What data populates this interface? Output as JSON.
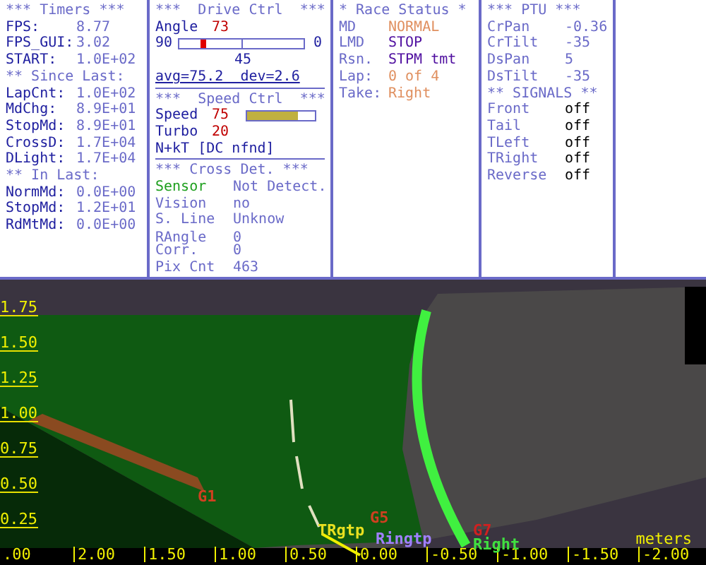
{
  "timers": {
    "sections": [
      {
        "title": "*** Timers ***",
        "rows": [
          {
            "label": "FPS:",
            "value": "8.77"
          },
          {
            "label": "FPS_GUI:",
            "value": "3.02"
          },
          {
            "label": "START:",
            "value": "1.0E+02"
          }
        ]
      },
      {
        "title": "** Since Last:",
        "rows": [
          {
            "label": "LapCnt:",
            "value": "1.0E+02"
          },
          {
            "label": "MdChg:",
            "value": "8.9E+01"
          },
          {
            "label": "StopMd:",
            "value": "8.9E+01"
          },
          {
            "label": "CrossD:",
            "value": "1.7E+04"
          },
          {
            "label": "DLight:",
            "value": "1.7E+04"
          }
        ]
      },
      {
        "title": "** In Last:",
        "rows": [
          {
            "label": "NormMd:",
            "value": "0.0E+00"
          },
          {
            "label": "StopMd:",
            "value": "1.2E+01"
          },
          {
            "label": "RdMtMd:",
            "value": "0.0E+00"
          }
        ]
      }
    ]
  },
  "drive_ctrl": {
    "title": "***  Drive Ctrl  ***",
    "angle_label": "Angle",
    "angle_value": "73",
    "slider_min": "90",
    "slider_max": "0",
    "level": 0.19,
    "slider_mid": "45",
    "stats": "avg=75.2  dev=2.6"
  },
  "speed_ctrl": {
    "title": "***  Speed Ctrl  ***",
    "speed_label": "Speed",
    "speed_value": "75",
    "level": 0.75,
    "turbo_label": "Turbo",
    "turbo_value": "20",
    "mode": "N+kT [DC nfnd]"
  },
  "cross_det": {
    "title": "*** Cross Det. ***",
    "rows": [
      {
        "label": "Sensor",
        "value": "Not Detect.",
        "highlighted": true
      },
      {
        "label": "Vision",
        "value": "no",
        "highlighted": false
      },
      {
        "label": "S. Line",
        "value": "Unknow",
        "highlighted": false
      },
      {
        "label": "RAngle",
        "value": "0",
        "highlighted": false
      },
      {
        "label": "Corr.",
        "value": "0",
        "highlighted": false
      },
      {
        "label": "Pix Cnt",
        "value": "463",
        "highlighted": false
      }
    ]
  },
  "race_status": {
    "title": "* Race Status *",
    "rows": [
      {
        "label": "MD",
        "value": "NORMAL",
        "color": "#e09060"
      },
      {
        "label": "LMD",
        "value": "STOP",
        "color": "#5010a0"
      },
      {
        "label": "Rsn.",
        "value": "STPM tmt",
        "color": "#5010a0"
      },
      {
        "label": "Lap:",
        "value": "0 of 4",
        "color": "#e09060"
      },
      {
        "label": "Take:",
        "value": "Right",
        "color": "#e09060"
      }
    ]
  },
  "ptu": {
    "title": "*** PTU ***",
    "rows": [
      {
        "label": "CrPan",
        "value": "-0.36"
      },
      {
        "label": "CrTilt",
        "value": "-35"
      },
      {
        "label": "DsPan",
        "value": "5"
      },
      {
        "label": "DsTilt",
        "value": "-35"
      }
    ],
    "signals_title": "** SIGNALS **",
    "signals": [
      {
        "label": "Front",
        "value": "off"
      },
      {
        "label": "Tail",
        "value": "off"
      },
      {
        "label": "TLeft",
        "value": "off"
      },
      {
        "label": "TRight",
        "value": "off"
      },
      {
        "label": "Reverse",
        "value": "off"
      }
    ]
  },
  "scene": {
    "y_ticks": [
      "1.75",
      "1.50",
      "1.25",
      "1.00",
      "0.75",
      "0.50",
      "0.25"
    ],
    "x_ticks": [
      ".00",
      "2.00",
      "1.50",
      "1.00",
      "0.50",
      "0.00",
      "-0.50",
      "-1.00",
      "-1.50",
      "-2.00"
    ],
    "unit": "meters",
    "markers": [
      {
        "label": "G1",
        "color": "#d04020"
      },
      {
        "label": "TRgtp",
        "color": "#e8e020"
      },
      {
        "label": "G5",
        "color": "#d04020"
      },
      {
        "label": "Ringtp",
        "color": "#a080ff"
      },
      {
        "label": "G7",
        "color": "#d02020"
      },
      {
        "label": "Right",
        "color": "#40e040"
      }
    ]
  }
}
